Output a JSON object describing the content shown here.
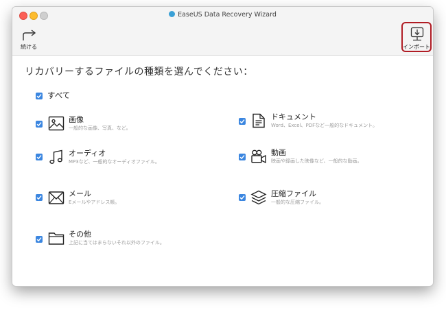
{
  "window": {
    "title": "EaseUS Data Recovery Wizard"
  },
  "toolbar": {
    "continue_label": "続ける",
    "import_label": "インポート"
  },
  "main": {
    "heading": "リカバリーするファイルの種類を選んでください：",
    "all_label": "すべて",
    "categories": [
      {
        "title": "画像",
        "desc": "一般的な画像、写真、など。",
        "icon": "image-icon",
        "checked": true
      },
      {
        "title": "ドキュメント",
        "desc": "Word、Excel、PDFなど一般的なドキュメント。",
        "icon": "document-icon",
        "checked": true
      },
      {
        "title": "オーディオ",
        "desc": "MP3など、一般的なオーディオファイル。",
        "icon": "music-note-icon",
        "checked": true
      },
      {
        "title": "動画",
        "desc": "映画や録画した映像など、一般的な動画。",
        "icon": "video-camera-icon",
        "checked": true
      },
      {
        "title": "メール",
        "desc": "Eメールやアドレス帳。",
        "icon": "mail-icon",
        "checked": true
      },
      {
        "title": "圧縮ファイル",
        "desc": "一般的な圧縮ファイル。",
        "icon": "archive-layers-icon",
        "checked": true
      },
      {
        "title": "その他",
        "desc": "上記に当てはまらないそれ以外のファイル。",
        "icon": "folder-icon",
        "checked": true
      }
    ]
  },
  "colors": {
    "checkbox": "#3b86e0",
    "import_highlight": "#b01c24"
  }
}
